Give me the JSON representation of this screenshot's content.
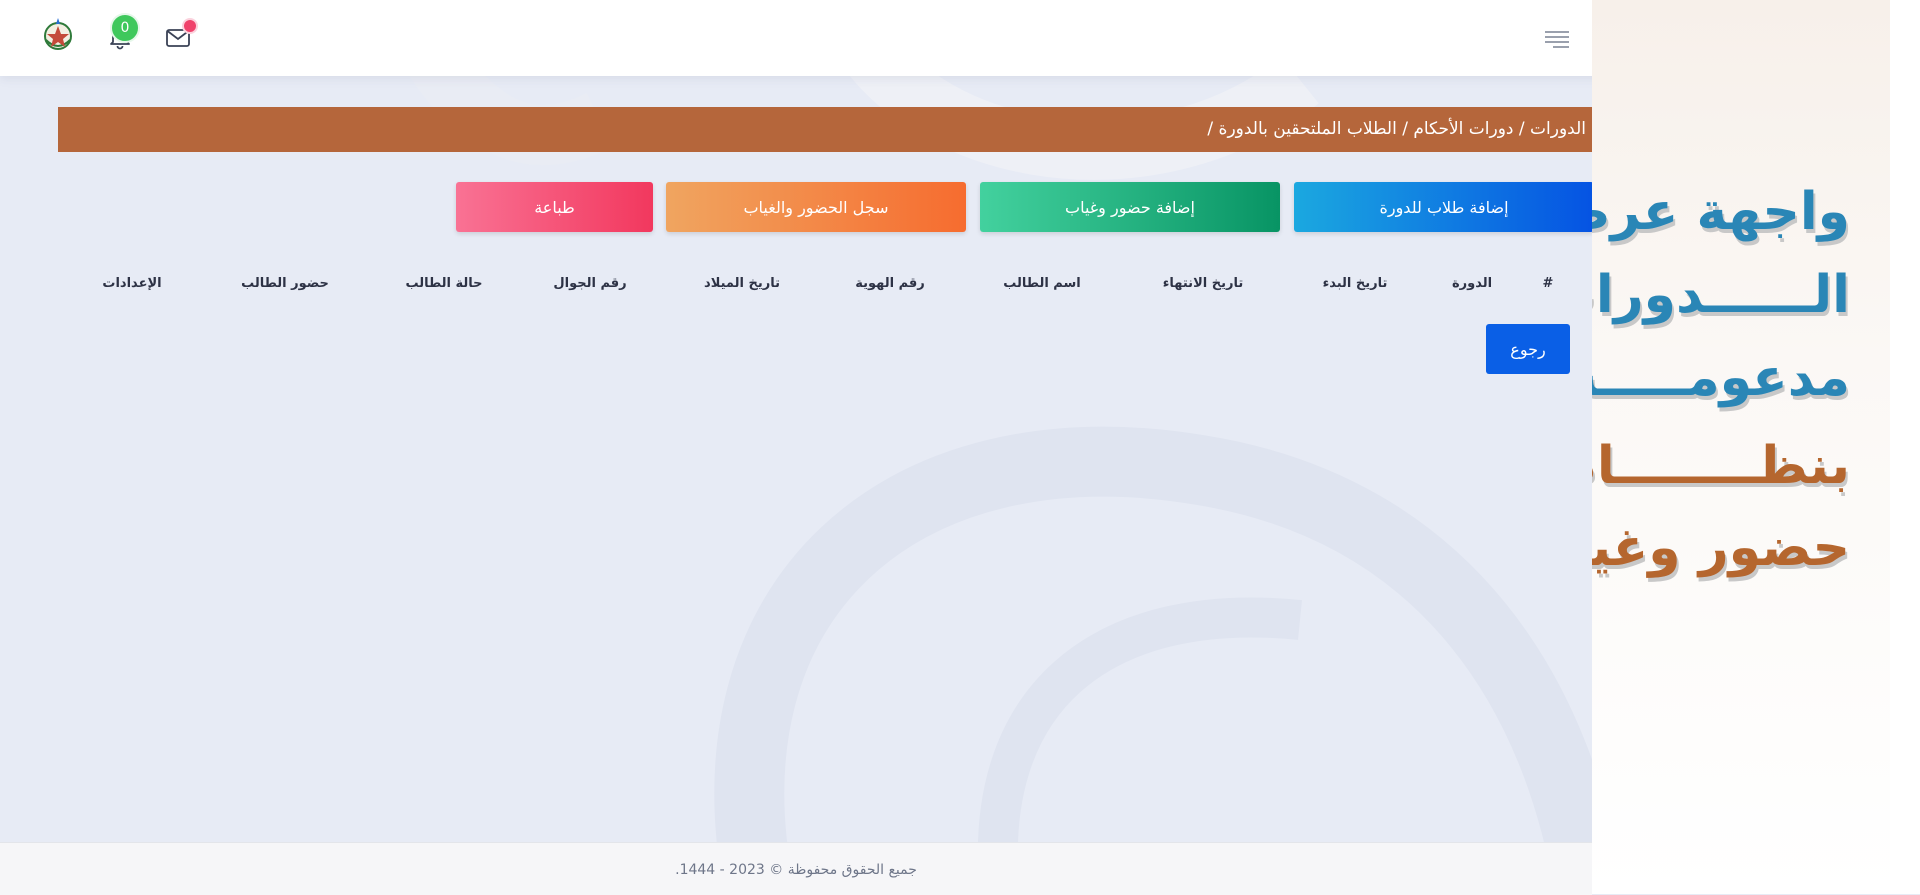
{
  "header": {
    "notification_count": "0",
    "icons": [
      "logo-emblem",
      "bell-icon",
      "mail-icon",
      "menu-icon"
    ]
  },
  "breadcrumb": "الدورات / دورات الأحكام / الطلاب الملتحقين بالدورة /",
  "actions": {
    "add_students": "إضافة طلاب للدورة",
    "add_attendance": "إضافة حضور وغياب",
    "attendance_log": "سجل الحضور والغياب",
    "print": "طباعة"
  },
  "table": {
    "headers": [
      "#",
      "الدورة",
      "تاريخ البدء",
      "تاريخ الانتهاء",
      "اسم الطالب",
      "رقم الهوية",
      "تاريخ الميلاد",
      "رقم الجوال",
      "حالة الطالب",
      "حضور الطالب",
      "الإعدادات"
    ]
  },
  "back_label": "رجوع",
  "footer": "جميع الحقوق محفوظة © 2023 - 1444.",
  "promo": {
    "lines": [
      "واجهة عرض",
      "الــــــدورات",
      "مدعومـــــة",
      "بنظــــــــام",
      "حضور وغياب"
    ]
  },
  "colors": {
    "breadcrumb": "#b5663b",
    "promo_blue": "#2a86b6",
    "promo_brown": "#b5662e",
    "badge_green": "#3fc85c"
  }
}
